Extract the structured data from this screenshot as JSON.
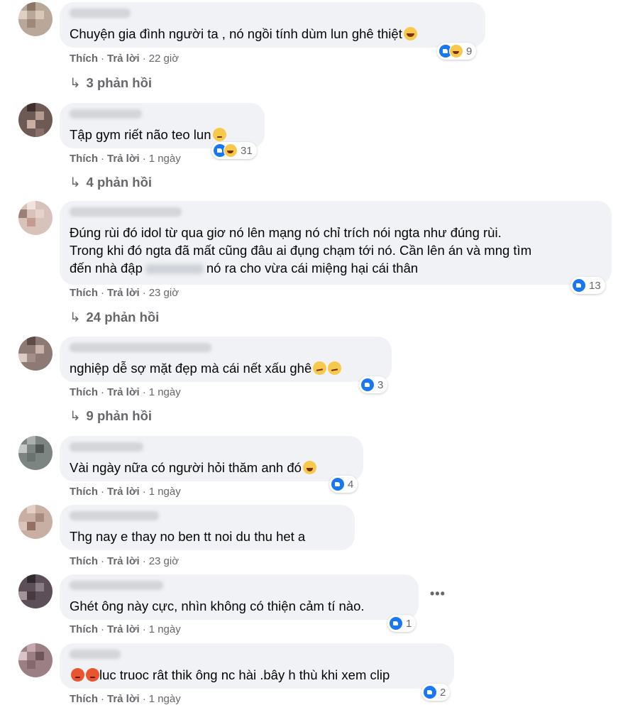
{
  "actions": {
    "like": "Thích",
    "reply": "Trả lời",
    "sep": "·"
  },
  "more_icon": "more-horizontal-icon",
  "comments": [
    {
      "text": "Chuyện gia đình người ta , nó ngồi tính dùm lun ghê thiệt",
      "emoji_after": "tears-of-joy",
      "reactions": [
        "like",
        "haha"
      ],
      "reaction_count": "9",
      "time": "22 giờ",
      "replies": "3 phản hồi"
    },
    {
      "text": "Tập gym riết não teo lun",
      "emoji_after": "pleading",
      "reactions": [
        "like",
        "haha"
      ],
      "reaction_count": "31",
      "time": "1 ngày",
      "replies": "4 phản hồi"
    },
    {
      "lines": [
        "Đúng rùi đó idol từ qua giơ nó lên mạng nó chỉ trích nói ngta như đúng rùi.",
        "Trong khi đó ngta đã mất cũng đâu ai đụng chạm tới nó. Cần lên án và mng tìm",
        "đến nhà đập",
        "nó ra cho vừa cái miệng hại cái thân"
      ],
      "reactions": [
        "like"
      ],
      "reaction_count": "13",
      "time": "23 giờ",
      "replies": "24 phản hồi"
    },
    {
      "text": "nghiệp dễ sợ mặt đẹp mà cái nết xấu ghê",
      "emoji_after": "smirk",
      "reactions": [
        "like"
      ],
      "reaction_count": "3",
      "time": "1 ngày",
      "replies": "9 phản hồi"
    },
    {
      "text": "Vài ngày nữa có người hỏi thăm anh đó",
      "emoji_after": "laughing",
      "reactions": [
        "like"
      ],
      "reaction_count": "4",
      "time": "1 ngày"
    },
    {
      "text": "Thg nay e thay no ben tt noi du thu het a",
      "time": "23 giờ"
    },
    {
      "text": "Ghét ông này cực, nhìn không có thiện cảm tí nào.",
      "reactions": [
        "like"
      ],
      "reaction_count": "1",
      "time": "1 ngày"
    },
    {
      "text": "luc truoc rât thik ông nc hài .bây h thù khi xem clip",
      "emoji_before": "angry",
      "reactions": [
        "like"
      ],
      "reaction_count": "2",
      "time": "1 ngày"
    }
  ]
}
